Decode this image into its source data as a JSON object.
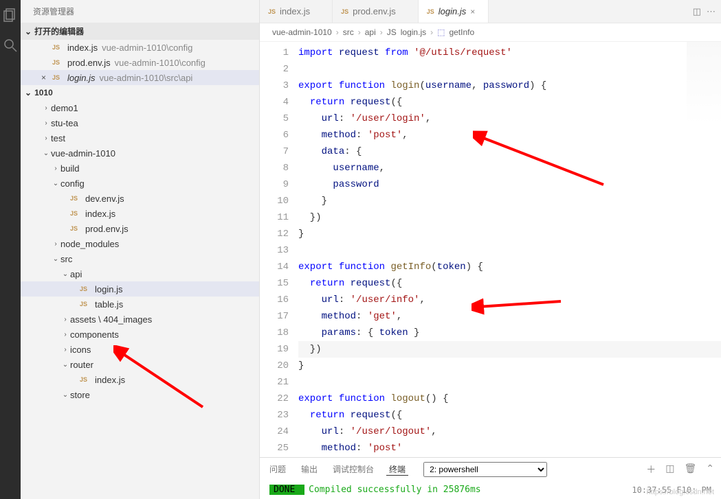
{
  "sidebar": {
    "title": "资源管理器",
    "openEditorsLabel": "打开的编辑器",
    "openEditors": [
      {
        "name": "index.js",
        "path": "vue-admin-1010\\config",
        "close": ""
      },
      {
        "name": "prod.env.js",
        "path": "vue-admin-1010\\config",
        "close": ""
      },
      {
        "name": "login.js",
        "path": "vue-admin-1010\\src\\api",
        "close": "×",
        "italic": true,
        "selected": true
      }
    ],
    "workspaceLabel": "1010",
    "tree": [
      {
        "name": "demo1",
        "type": "folder",
        "open": false,
        "depth": 1
      },
      {
        "name": "stu-tea",
        "type": "folder",
        "open": false,
        "depth": 1
      },
      {
        "name": "test",
        "type": "folder",
        "open": false,
        "depth": 1
      },
      {
        "name": "vue-admin-1010",
        "type": "folder",
        "open": true,
        "depth": 1
      },
      {
        "name": "build",
        "type": "folder",
        "open": false,
        "depth": 2
      },
      {
        "name": "config",
        "type": "folder",
        "open": true,
        "depth": 2
      },
      {
        "name": "dev.env.js",
        "type": "file",
        "depth": 3
      },
      {
        "name": "index.js",
        "type": "file",
        "depth": 3
      },
      {
        "name": "prod.env.js",
        "type": "file",
        "depth": 3
      },
      {
        "name": "node_modules",
        "type": "folder",
        "open": false,
        "depth": 2
      },
      {
        "name": "src",
        "type": "folder",
        "open": true,
        "depth": 2
      },
      {
        "name": "api",
        "type": "folder",
        "open": true,
        "depth": 3
      },
      {
        "name": "login.js",
        "type": "file",
        "depth": 4,
        "selected": true
      },
      {
        "name": "table.js",
        "type": "file",
        "depth": 4
      },
      {
        "name": "assets \\ 404_images",
        "type": "folder",
        "open": false,
        "depth": 3
      },
      {
        "name": "components",
        "type": "folder",
        "open": false,
        "depth": 3
      },
      {
        "name": "icons",
        "type": "folder",
        "open": false,
        "depth": 3
      },
      {
        "name": "router",
        "type": "folder",
        "open": true,
        "depth": 3
      },
      {
        "name": "index.js",
        "type": "file",
        "depth": 4
      },
      {
        "name": "store",
        "type": "folder",
        "open": true,
        "depth": 3
      }
    ]
  },
  "tabs": [
    {
      "label": "index.js",
      "active": false
    },
    {
      "label": "prod.env.js",
      "active": false
    },
    {
      "label": "login.js",
      "active": true,
      "italic": true,
      "close": "×"
    }
  ],
  "breadcrumbs": {
    "seg1": "vue-admin-1010",
    "seg2": "src",
    "seg3": "api",
    "seg4": "login.js",
    "seg5": "getInfo"
  },
  "code": {
    "lines": 25,
    "text": {
      "l1": "import request from '@/utils/request'",
      "l2": "",
      "l3": "export function login(username, password) {",
      "l4": "  return request({",
      "l5": "    url: '/user/login',",
      "l6": "    method: 'post',",
      "l7": "    data: {",
      "l8": "      username,",
      "l9": "      password",
      "l10": "    }",
      "l11": "  })",
      "l12": "}",
      "l13": "",
      "l14": "export function getInfo(token) {",
      "l15": "  return request({",
      "l16": "    url: '/user/info',",
      "l17": "    method: 'get',",
      "l18": "    params: { token }",
      "l19": "  })",
      "l20": "}",
      "l21": "",
      "l22": "export function logout() {",
      "l23": "  return request({",
      "l24": "    url: '/user/logout',",
      "l25": "    method: 'post'"
    }
  },
  "terminal": {
    "tabs": {
      "problems": "问题",
      "output": "输出",
      "debug": "调试控制台",
      "term": "终端"
    },
    "dropdown": "2: powershell",
    "doneLabel": " DONE ",
    "message": "Compiled successfully in 25876ms",
    "timestamp": "10:37:55    F10: PM"
  },
  "watermark": "https://blog.csdn.net"
}
